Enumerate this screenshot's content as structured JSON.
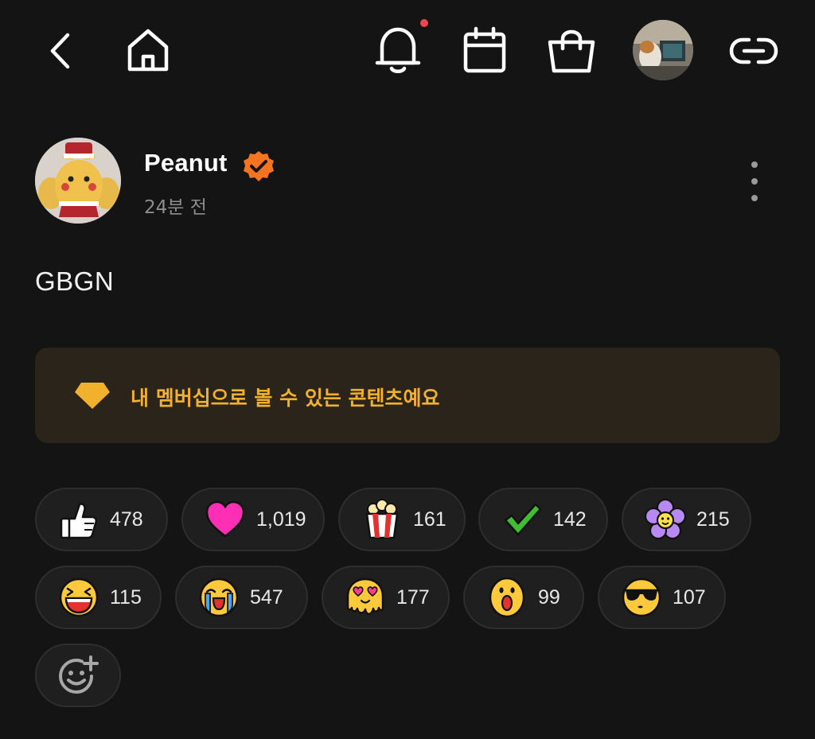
{
  "topbar": {
    "icons": [
      "back-icon",
      "home-icon",
      "bell-icon",
      "calendar-icon",
      "shopping-bag-icon",
      "profile-avatar",
      "link-icon"
    ],
    "has_notification": true,
    "accent_notification_color": "#f04452"
  },
  "post": {
    "author": "Peanut",
    "verified": true,
    "time": "24분 전",
    "text": "GBGN"
  },
  "membership_banner": {
    "text": "내 멤버십으로 볼 수 있는 콘텐츠예요",
    "color": "#f2b12c"
  },
  "reactions": [
    {
      "icon": "thumbs-up-icon",
      "count": "478"
    },
    {
      "icon": "heart-icon",
      "count": "1,019"
    },
    {
      "icon": "popcorn-icon",
      "count": "161"
    },
    {
      "icon": "checkmark-icon",
      "count": "142"
    },
    {
      "icon": "flower-icon",
      "count": "215"
    },
    {
      "icon": "laughing-face-icon",
      "count": "115"
    },
    {
      "icon": "crying-face-icon",
      "count": "547"
    },
    {
      "icon": "heart-eyes-melting-face-icon",
      "count": "177"
    },
    {
      "icon": "surprised-face-icon",
      "count": "99"
    },
    {
      "icon": "sunglasses-face-icon",
      "count": "107"
    }
  ],
  "add_reaction_icon": "add-reaction-icon"
}
